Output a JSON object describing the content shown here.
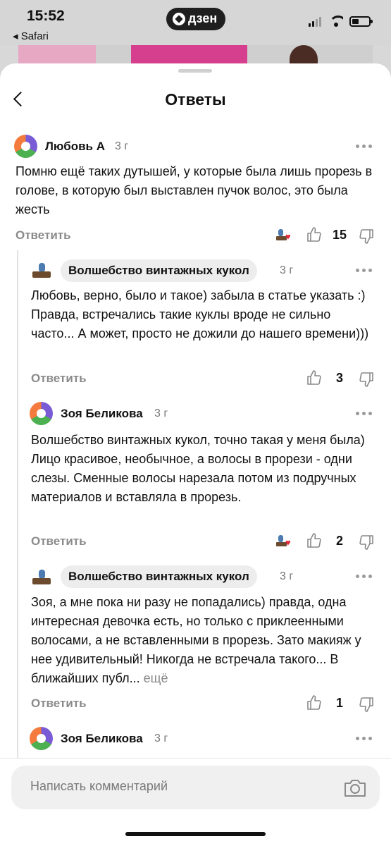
{
  "status_bar": {
    "time": "15:52",
    "back_app": "◂ Safari",
    "app_badge": "дзен"
  },
  "header": {
    "title": "Ответы"
  },
  "comments": [
    {
      "author": "Любовь А",
      "age": "3 г",
      "text": "Помню ещё таких дутышей, у которые была лишь прорезь в голове, в которую был выставлен пучок волос, это была жесть",
      "reply_label": "Ответить",
      "likes": "15",
      "has_reaction": true
    },
    {
      "author": "Волшебство винтажных кукол",
      "age": "3 г",
      "text": "Любовь, верно, было и такое) забыла в статье указать :) Правда, встречались такие куклы вроде не сильно часто... А может, просто не дожили до нашего времени)))",
      "reply_label": "Ответить",
      "likes": "3",
      "has_reaction": false
    },
    {
      "author": "Зоя Беликова",
      "age": "3 г",
      "text": "Волшебство винтажных кукол, точно такая у меня была) Лицо красивое, необычное, а волосы в прорези - одни слезы. Сменные волосы нарезала потом из подручных материалов и вставляла в прорезь.",
      "reply_label": "Ответить",
      "likes": "2",
      "has_reaction": true
    },
    {
      "author": "Волшебство винтажных кукол",
      "age": "3 г",
      "text": "Зоя, а мне пока ни разу не попадались) правда, одна интересная девочка есть, но только с приклеенными волосами, а не вставленными в прорезь. Зато макияж у нее удивительный! Никогда не встречала такого... В ближайших публ...",
      "more_label": "ещё",
      "reply_label": "Ответить",
      "likes": "1",
      "has_reaction": false
    },
    {
      "author": "Зоя Беликова",
      "age": "3 г"
    }
  ],
  "compose": {
    "placeholder": "Написать комментарий"
  },
  "colors": {
    "reaction_heart": "#e2283a",
    "author_pill_bg": "#ededed",
    "muted_text": "#8a8a8a"
  }
}
